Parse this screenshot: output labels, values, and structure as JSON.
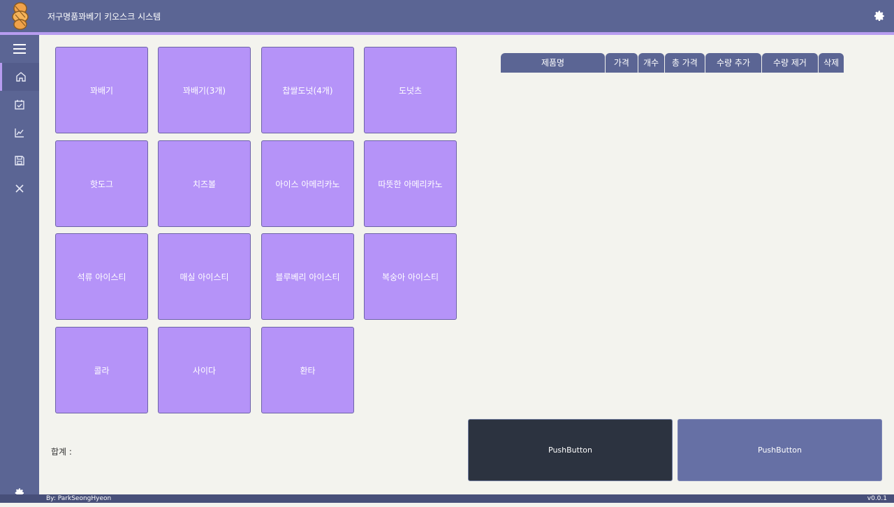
{
  "app": {
    "title": "저구명품꽈베기 키오스크 시스템",
    "author": "By: ParkSeongHyeon",
    "version": "v0.0.1"
  },
  "sidebar": {
    "items": [
      {
        "icon": "menu-icon"
      },
      {
        "icon": "home-icon",
        "active": true
      },
      {
        "icon": "calendar-check-icon"
      },
      {
        "icon": "chart-icon"
      },
      {
        "icon": "save-icon"
      },
      {
        "icon": "close-icon"
      }
    ],
    "bottom_icon": "settings-icon"
  },
  "products": [
    "꽈배기",
    "꽈배기(3개)",
    "찹쌀도넛(4개)",
    "도넛츠",
    "핫도그",
    "치즈볼",
    "아이스 아메리카노",
    "따뜻한 아메리카노",
    "석류 아이스티",
    "매실 아이스티",
    "블루베리 아이스티",
    "복숭아 아이스티",
    "콜라",
    "사이다",
    "환타"
  ],
  "order_table": {
    "columns": [
      "제품명",
      "가격",
      "개수",
      "총 가격",
      "수량 추가",
      "수량 제거",
      "삭제"
    ]
  },
  "footer": {
    "total_label": "합계 :",
    "button_left": "PushButton",
    "button_right": "PushButton"
  },
  "colors": {
    "primary": "#5b6594",
    "accent": "#b79cf0",
    "product_button": "#b593f8",
    "dark_button": "#2c3340"
  }
}
